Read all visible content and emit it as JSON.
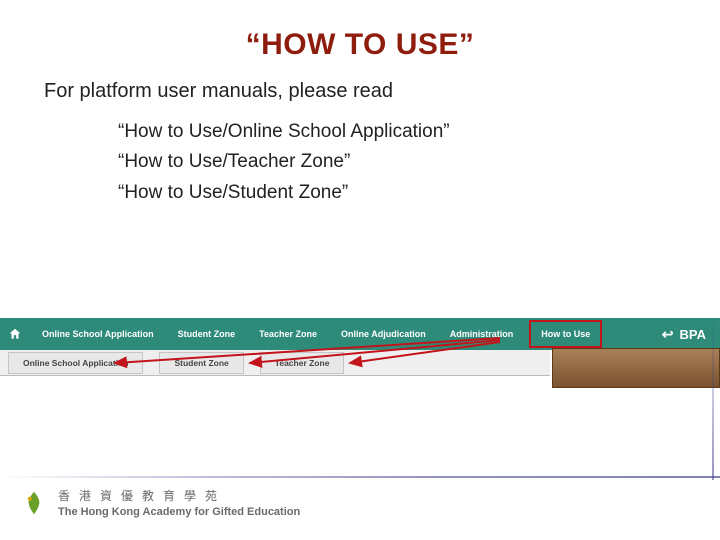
{
  "title": "“HOW TO USE”",
  "lead": "For platform user manuals, please read",
  "manuals": [
    "“How to Use/Online School Application”",
    "“How to Use/Teacher Zone”",
    "“How to Use/Student Zone”"
  ],
  "nav": [
    "Online School Application",
    "Student Zone",
    "Teacher Zone",
    "Online Adjudication",
    "Administration",
    "How to Use"
  ],
  "subnav": [
    "Online School Application",
    "Student Zone",
    "Teacher Zone"
  ],
  "brand": "BPA",
  "footer": {
    "cn": "香港資優教育學苑",
    "en": "The Hong Kong Academy for Gifted Education"
  }
}
